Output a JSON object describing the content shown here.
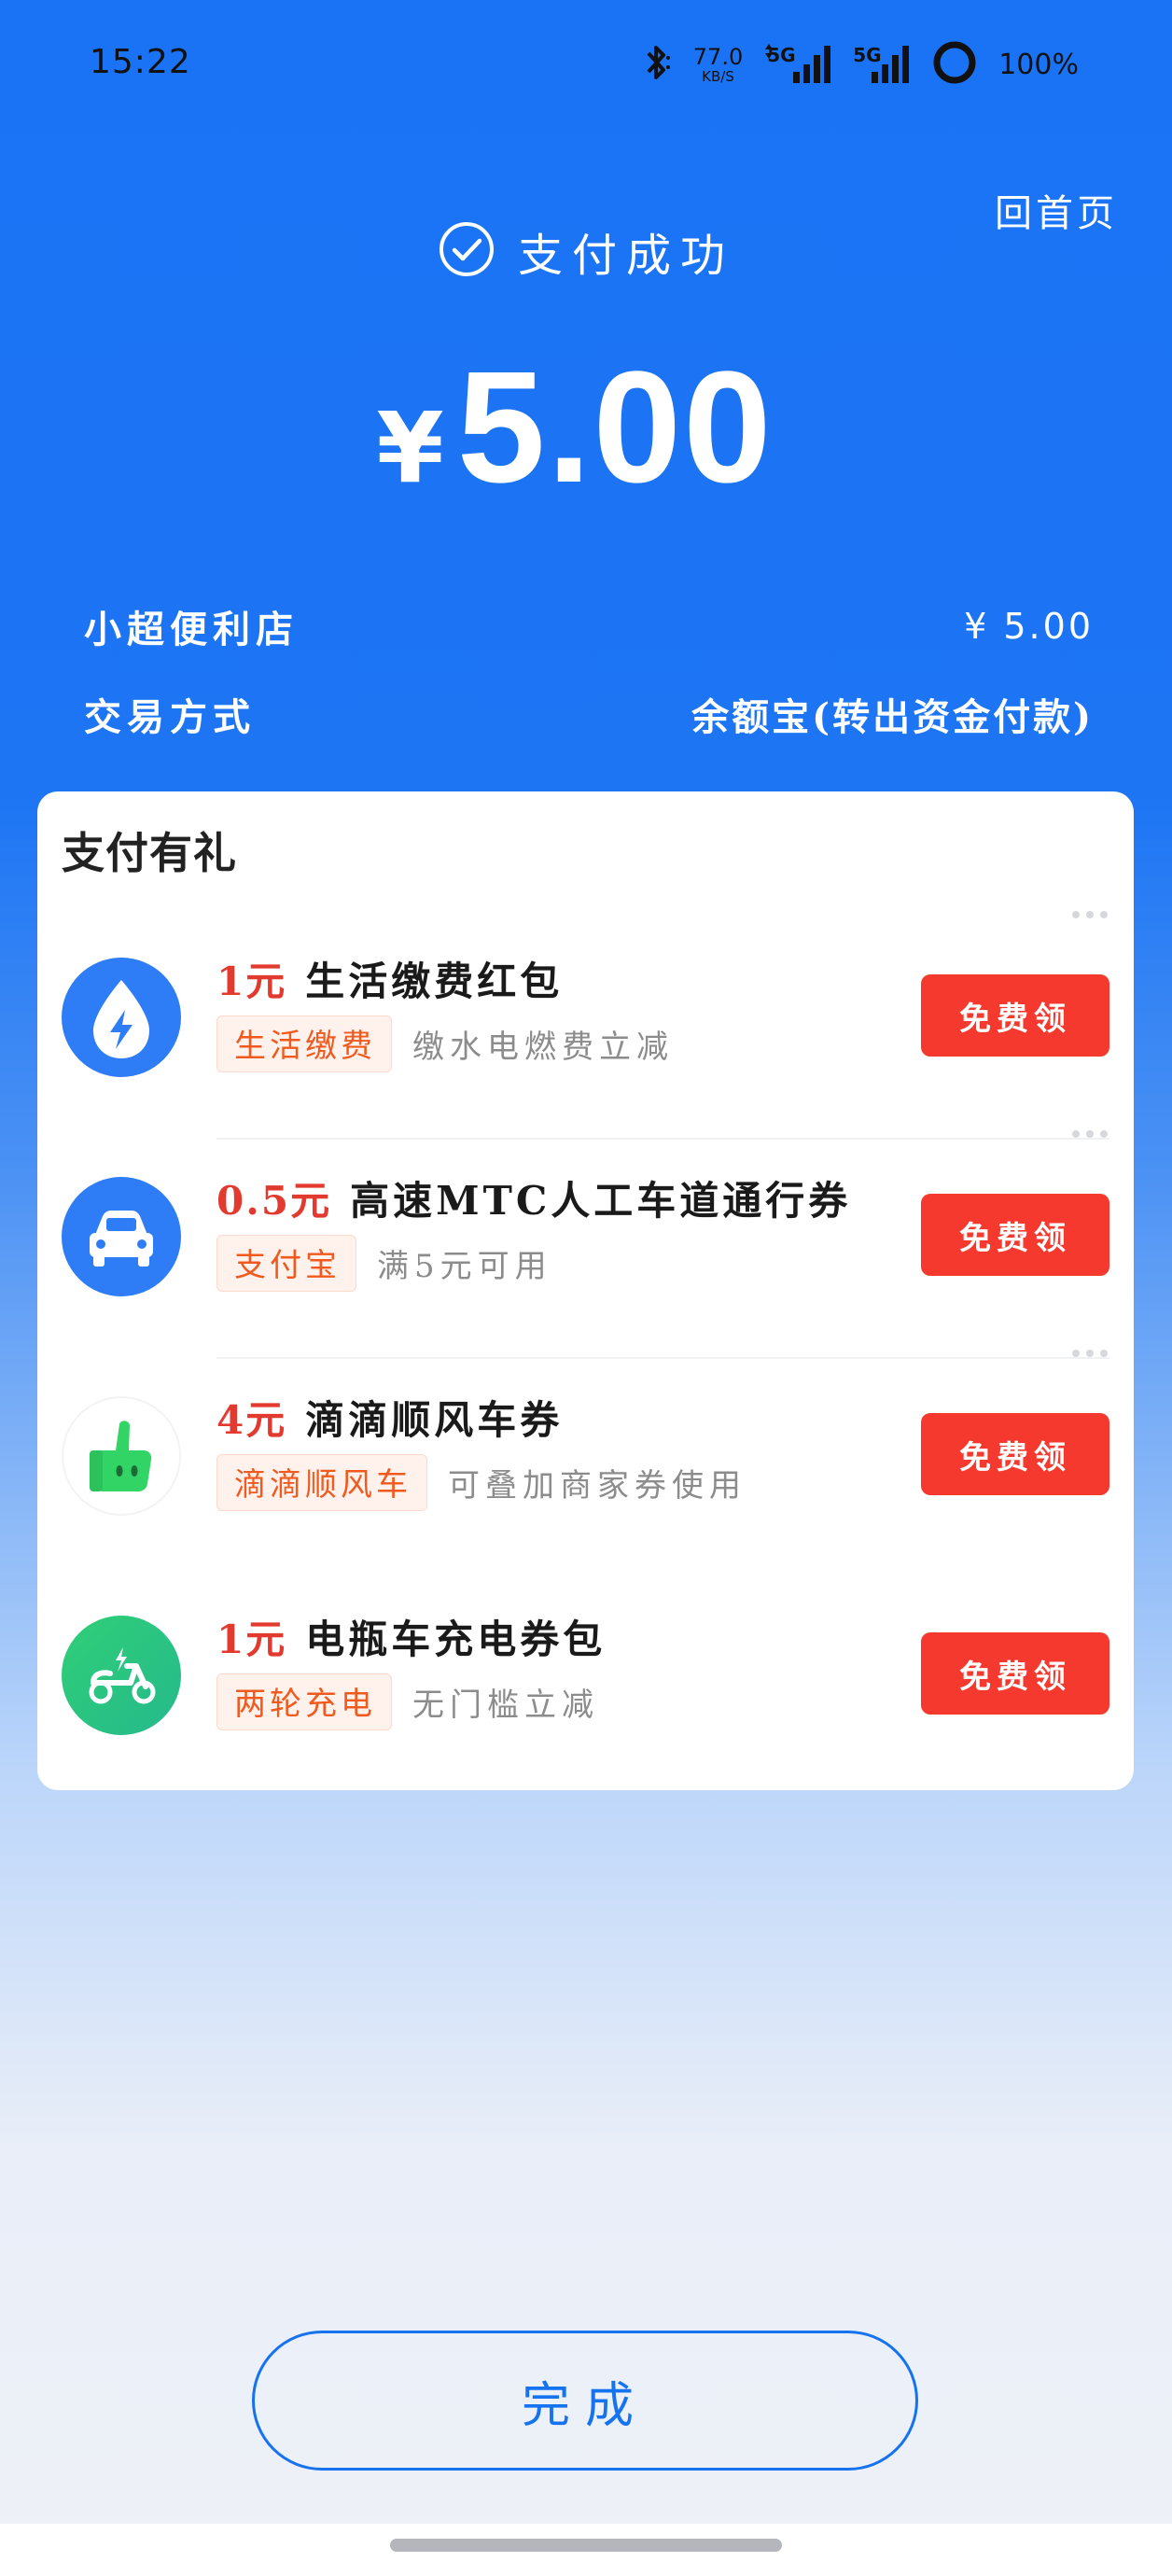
{
  "status_bar": {
    "time": "15:22",
    "net_speed_value": "77.0",
    "net_speed_unit": "KB/S",
    "signal1_label": "5G",
    "signal2_label": "5G",
    "battery": "100%"
  },
  "header": {
    "home_link": "回首页",
    "success_text": "支付成功",
    "currency_symbol": "¥",
    "amount": "5.00"
  },
  "details": {
    "store_name": "小超便利店",
    "store_amount": "¥ 5.00",
    "method_label": "交易方式",
    "method_value": "余额宝(转出资金付款)"
  },
  "gifts": {
    "title": "支付有礼",
    "offers": [
      {
        "price": "1元",
        "name": "生活缴费红包",
        "tag": "生活缴费",
        "desc": "缴水电燃费立减",
        "button": "免费领",
        "icon": "lightning-drop-icon",
        "icon_color": "#2f7df6"
      },
      {
        "price": "0.5元",
        "name": "高速MTC人工车道通行券",
        "tag": "支付宝",
        "desc": "满5元可用",
        "button": "免费领",
        "icon": "car-icon",
        "icon_color": "#2f7df6"
      },
      {
        "price": "4元",
        "name": "滴滴顺风车券",
        "tag": "滴滴顺风车",
        "desc": "可叠加商家券使用",
        "button": "免费领",
        "icon": "thumbs-up-icon",
        "icon_color": "#33d466"
      },
      {
        "price": "1元",
        "name": "电瓶车充电券包",
        "tag": "两轮充电",
        "desc": "无门槛立减",
        "button": "免费领",
        "icon": "scooter-icon",
        "icon_color": "#2ac47f"
      }
    ]
  },
  "footer": {
    "done_label": "完成"
  },
  "colors": {
    "primary_blue": "#1a73f5",
    "accent_red": "#f6392f",
    "price_red": "#e23a2e",
    "tag_orange": "#f05a1f"
  }
}
